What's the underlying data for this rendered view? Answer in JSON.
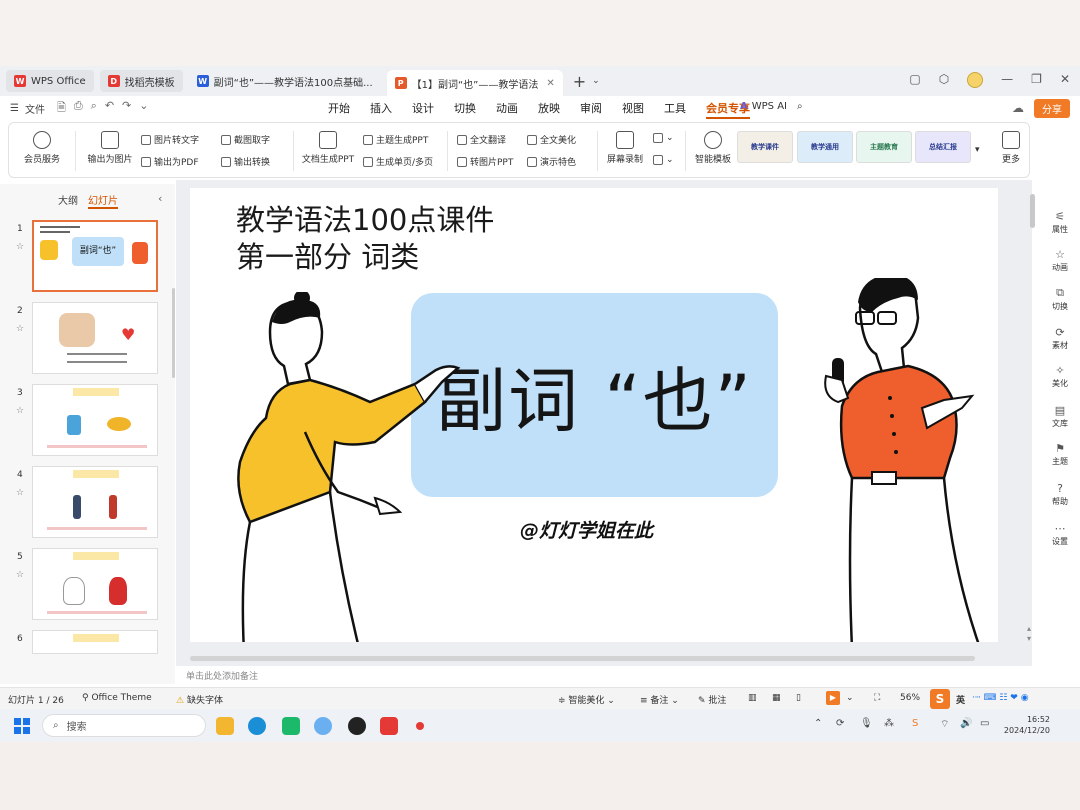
{
  "tabs": [
    {
      "label": "WPS Office",
      "color": "#e53935"
    },
    {
      "label": "找稻壳模板",
      "color": "#e53935"
    },
    {
      "label": "副词“也”——教学语法100点基础...",
      "color": "#2b5fd9"
    },
    {
      "label": "【1】副词“也”——教学语法",
      "color": "#e55a2b"
    }
  ],
  "menubar": {
    "file": "文件",
    "menus": [
      "开始",
      "插入",
      "设计",
      "切换",
      "动画",
      "放映",
      "审阅",
      "视图",
      "工具",
      "会员专享"
    ],
    "active_menu": "会员专享",
    "wps_ai": "WPS AI",
    "share": "分享"
  },
  "ribbon": {
    "member": "会员服务",
    "export_img": "输出为图片",
    "img_to_text": "图片转文字",
    "export_pdf": "输出为PDF",
    "screenshot_text": "截图取字",
    "export_convert": "输出转换",
    "doc_to_ppt": "文档生成PPT",
    "topic_ppt": "主题生成PPT",
    "gen_pages": "生成单页/多页",
    "translate": "全文翻译",
    "to_img_ppt": "转图片PPT",
    "beautify": "全文美化",
    "demo_feature": "演示特色",
    "screen_record": "屏幕录制",
    "smart_template": "智能模板",
    "more": "更多",
    "templates": [
      "教学课件",
      "教学通用",
      "主题教育",
      "总结汇报"
    ]
  },
  "left_panel": {
    "tab_outline": "大纲",
    "tab_slides": "幻灯片",
    "slide_numbers": [
      "1",
      "2",
      "3",
      "4",
      "5",
      "6"
    ],
    "thumb_texts": [
      "副词“也”",
      "",
      "",
      "",
      "",
      ""
    ]
  },
  "slide": {
    "title_line1": "教学语法100点课件",
    "title_line2": "第一部分 词类",
    "main_text": "副词 “也”",
    "author": "@灯灯学姐在此"
  },
  "notes_placeholder": "单击此处添加备注",
  "right_sidebar": [
    "属性",
    "动画",
    "切换",
    "素材",
    "美化",
    "文库",
    "主题",
    "帮助",
    "设置"
  ],
  "statusbar": {
    "slide_info": "幻灯片 1 / 26",
    "theme": "Office Theme",
    "missing_font": "缺失字体",
    "smart_beautify": "智能美化",
    "notes": "备注",
    "comments": "批注",
    "zoom": "56%",
    "ime": "英"
  },
  "taskbar": {
    "search_placeholder": "搜索",
    "time": "16:52",
    "date": "2024/12/20"
  },
  "colors": {
    "accent": "#d35400",
    "slide_box": "#bfe0f8",
    "woman_jacket": "#f6c12b",
    "man_shirt": "#ee5f2d",
    "heart": "#e53935"
  }
}
